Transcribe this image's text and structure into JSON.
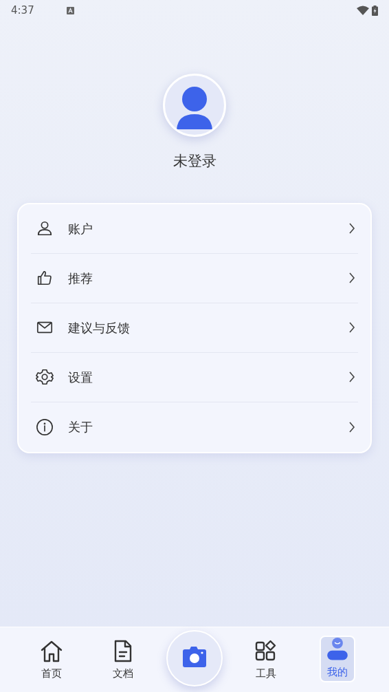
{
  "status_bar": {
    "time": "4:37"
  },
  "profile": {
    "name": "未登录"
  },
  "menu": [
    {
      "kind": "account",
      "label": "账户"
    },
    {
      "kind": "recommend",
      "label": "推荐"
    },
    {
      "kind": "feedback",
      "label": "建议与反馈"
    },
    {
      "kind": "settings",
      "label": "设置"
    },
    {
      "kind": "about",
      "label": "关于"
    }
  ],
  "bottom_nav": [
    {
      "kind": "home",
      "label": "首页",
      "selected": false
    },
    {
      "kind": "docs",
      "label": "文档",
      "selected": false
    },
    {
      "kind": "camera",
      "selected": false
    },
    {
      "kind": "tools",
      "label": "工具",
      "selected": false
    },
    {
      "kind": "me",
      "label": "我的",
      "selected": true
    }
  ]
}
